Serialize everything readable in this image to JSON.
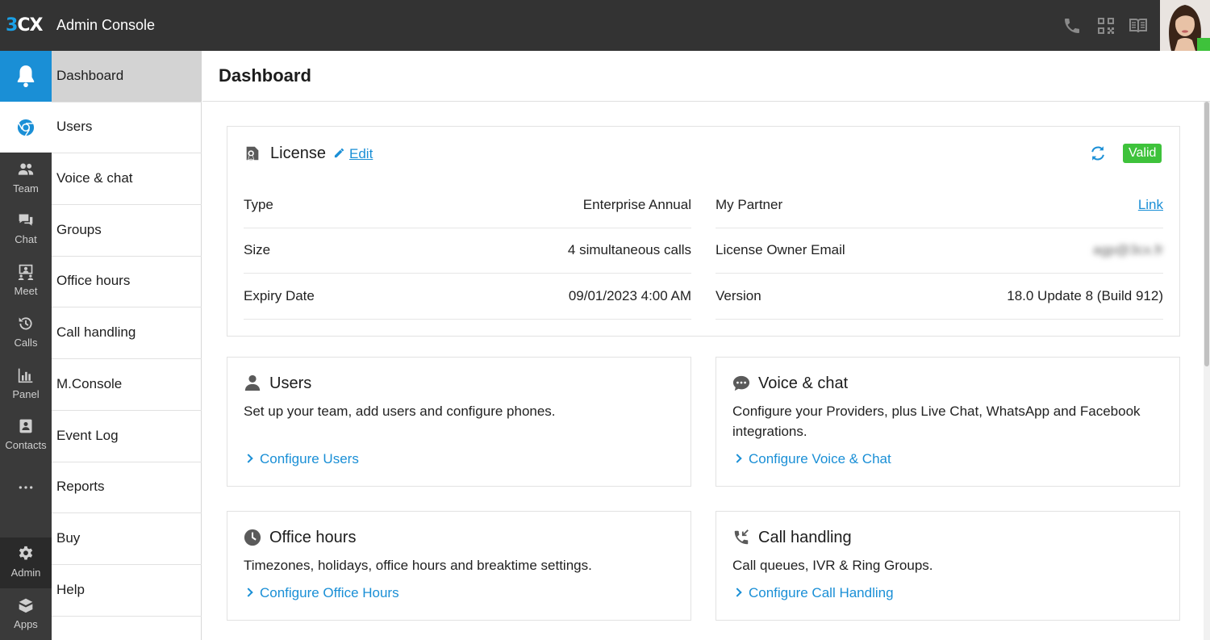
{
  "app": {
    "logo": "3CX",
    "title": "Admin Console"
  },
  "colors": {
    "accent": "#1a8fd6",
    "topbar": "#333333",
    "valid": "#3ec23b"
  },
  "topbar_icons": [
    "phone-icon",
    "qr-code-icon",
    "book-icon"
  ],
  "rail": {
    "items": [
      {
        "icon": "bell-icon",
        "label": ""
      },
      {
        "icon": "chrome-icon",
        "label": ""
      },
      {
        "icon": "team-icon",
        "label": "Team"
      },
      {
        "icon": "chat-icon",
        "label": "Chat"
      },
      {
        "icon": "meet-icon",
        "label": "Meet"
      },
      {
        "icon": "history-icon",
        "label": "Calls"
      },
      {
        "icon": "bar-chart-icon",
        "label": "Panel"
      },
      {
        "icon": "contacts-icon",
        "label": "Contacts"
      },
      {
        "icon": "more-icon",
        "label": ""
      },
      {
        "icon": "gear-icon",
        "label": "Admin"
      },
      {
        "icon": "apps-icon",
        "label": "Apps"
      }
    ]
  },
  "subnav": {
    "items": [
      "Dashboard",
      "Users",
      "Voice & chat",
      "Groups",
      "Office hours",
      "Call handling",
      "M.Console",
      "Event Log",
      "Reports",
      "Buy",
      "Help"
    ]
  },
  "page": {
    "title": "Dashboard"
  },
  "license": {
    "title": "License",
    "edit_label": "Edit",
    "status": "Valid",
    "left": [
      {
        "key": "Type",
        "value": "Enterprise Annual"
      },
      {
        "key": "Size",
        "value": "4 simultaneous calls"
      },
      {
        "key": "Expiry Date",
        "value": "09/01/2023 4:00 AM"
      }
    ],
    "right": [
      {
        "key": "My Partner",
        "value": "Link"
      },
      {
        "key": "License Owner Email",
        "value": "agp@3cx.fr"
      },
      {
        "key": "Version",
        "value": "18.0 Update 8 (Build 912)"
      }
    ]
  },
  "cards": {
    "users": {
      "title": "Users",
      "desc": "Set up your team, add users and configure phones.",
      "link": "Configure Users"
    },
    "voice": {
      "title": "Voice & chat",
      "desc": "Configure your Providers, plus Live Chat, WhatsApp and Facebook integrations.",
      "link": "Configure Voice & Chat"
    },
    "office": {
      "title": "Office hours",
      "desc": "Timezones, holidays, office hours and breaktime settings.",
      "link": "Configure Office Hours"
    },
    "callhandling": {
      "title": "Call handling",
      "desc": "Call queues, IVR & Ring Groups.",
      "link": "Configure Call Handling"
    }
  }
}
